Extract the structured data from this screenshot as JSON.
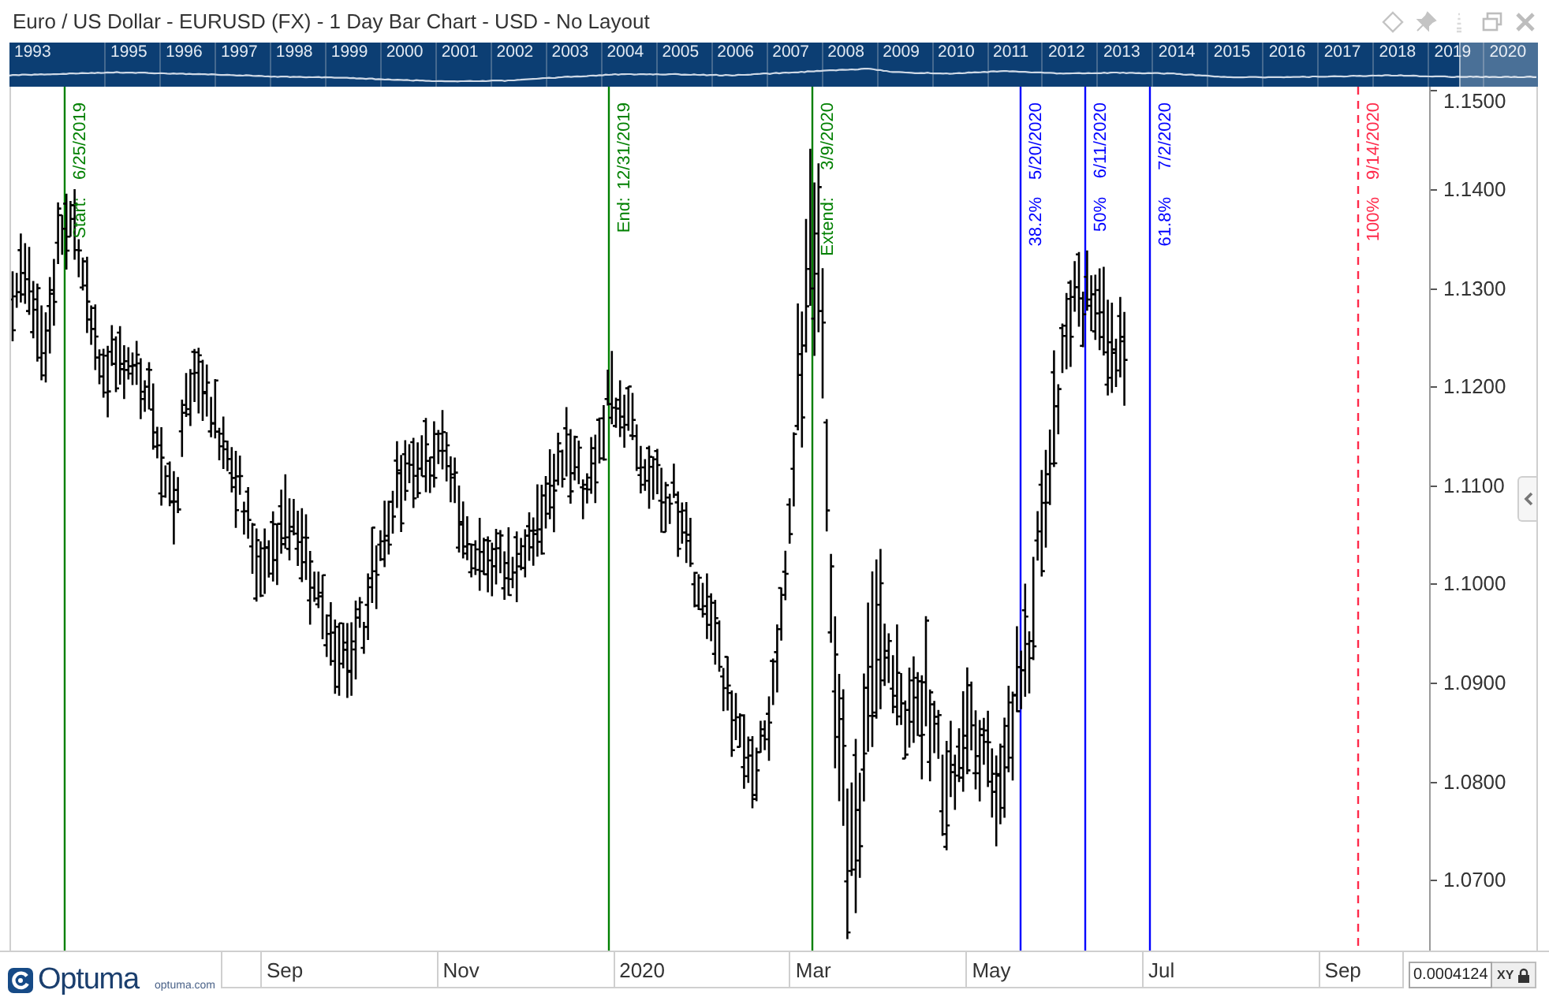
{
  "window": {
    "title": "Euro / US Dollar - EURUSD (FX) - 1 Day Bar Chart - USD - No Layout"
  },
  "navigator": {
    "years": [
      "1993",
      "1995",
      "1996",
      "1997",
      "1998",
      "1999",
      "2000",
      "2001",
      "2002",
      "2003",
      "2004",
      "2005",
      "2006",
      "2007",
      "2008",
      "2009",
      "2010",
      "2011",
      "2012",
      "2013",
      "2014",
      "2015",
      "2016",
      "2017",
      "2018",
      "2019",
      "2020"
    ]
  },
  "chart": {
    "price_ticks": [
      "1.1500",
      "1.1400",
      "1.1300",
      "1.1200",
      "1.1100",
      "1.1000",
      "1.0900",
      "1.0800",
      "1.0700"
    ],
    "time_labels": [
      "Sep",
      "Nov",
      "2020",
      "Mar",
      "May",
      "Jul",
      "Sep"
    ],
    "cycle_lines": [
      {
        "kind": "solid",
        "color": "#008000",
        "name": "Start:",
        "date": "6/25/2019"
      },
      {
        "kind": "solid",
        "color": "#008000",
        "name": "End:",
        "date": "12/31/2019"
      },
      {
        "kind": "solid",
        "color": "#008000",
        "name": "Extend:",
        "date": "3/9/2020"
      },
      {
        "kind": "solid",
        "color": "#0000ff",
        "name": "38.2%",
        "date": "5/20/2020"
      },
      {
        "kind": "solid",
        "color": "#0000ff",
        "name": "50%",
        "date": "6/11/2020"
      },
      {
        "kind": "solid",
        "color": "#0000ff",
        "name": "61.8%",
        "date": "7/2/2020"
      },
      {
        "kind": "dashed",
        "color": "#ff2a4a",
        "name": "100%",
        "date": "9/14/2020"
      }
    ]
  },
  "footer": {
    "brand": "Optuma",
    "website": "optuma.com",
    "cursor_value": "0.0004124",
    "xy_label": "XY"
  }
}
